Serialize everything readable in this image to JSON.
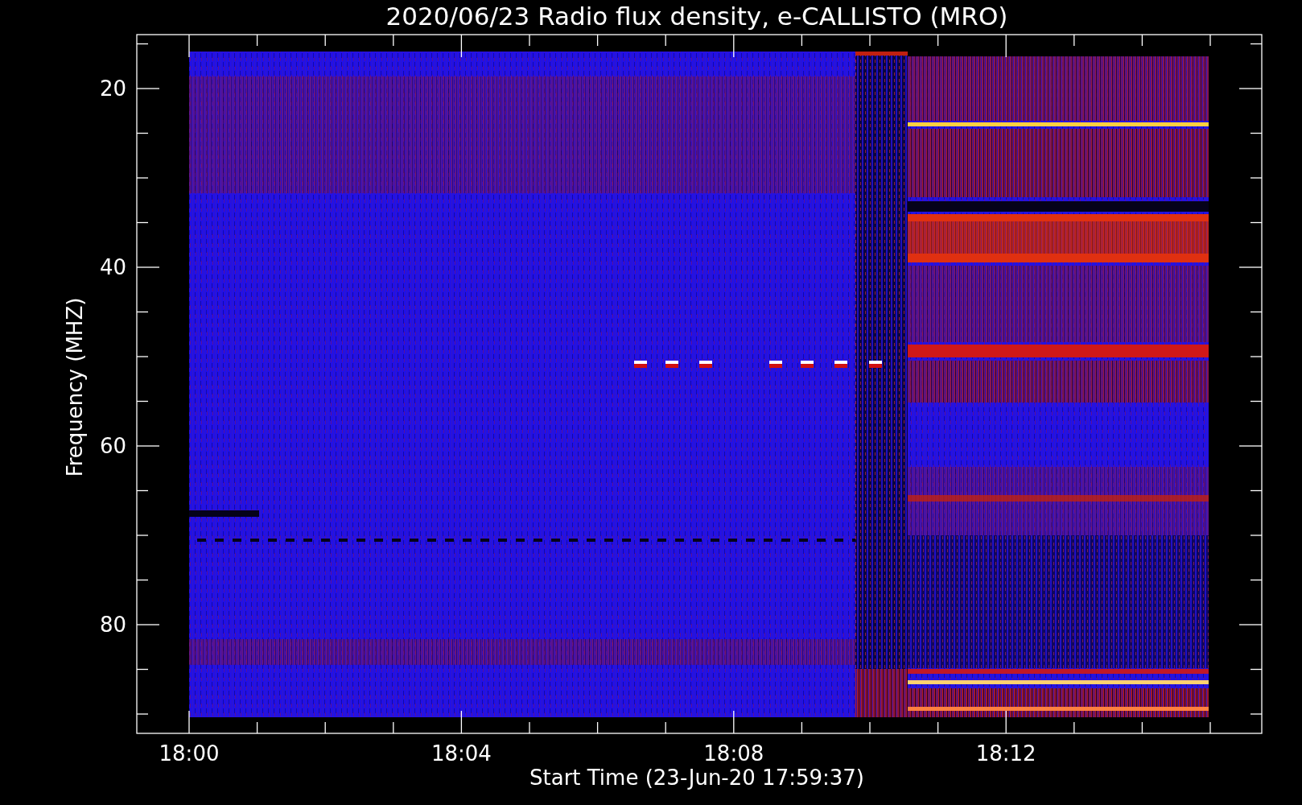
{
  "title": "2020/06/23  Radio flux density, e-CALLISTO (MRO)",
  "y_axis": {
    "title": "Frequency (MHZ)",
    "ticks": [
      "20",
      "40",
      "60",
      "80"
    ]
  },
  "x_axis": {
    "title": "Start Time (23-Jun-20 17:59:37)",
    "ticks": [
      "18:00",
      "18:04",
      "18:08",
      "18:12"
    ]
  }
}
